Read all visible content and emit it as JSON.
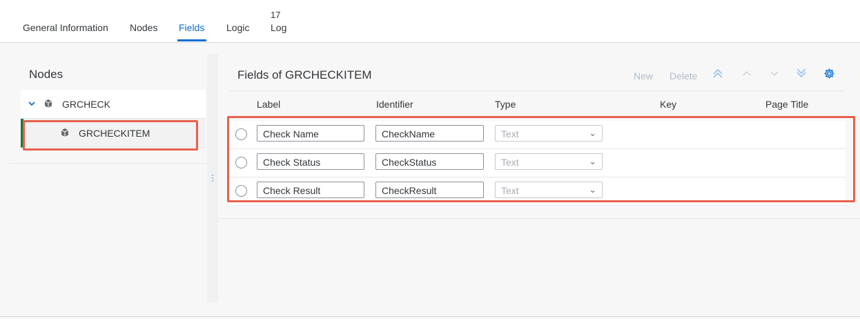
{
  "tabs": {
    "general": "General Information",
    "nodes": "Nodes",
    "fields": "Fields",
    "logic": "Logic",
    "log": "Log",
    "log_count": "17"
  },
  "nodes_panel": {
    "title": "Nodes",
    "items": [
      {
        "label": "GRCHECK",
        "expanded": true,
        "icon": "cubes-icon"
      },
      {
        "label": "GRCHECKITEM",
        "selected": true,
        "icon": "cubes-icon"
      }
    ]
  },
  "fields_panel": {
    "title": "Fields of GRCHECKITEM",
    "toolbar": {
      "new": "New",
      "delete": "Delete"
    },
    "columns": [
      "Label",
      "Identifier",
      "Type",
      "Key",
      "Page Title"
    ],
    "rows": [
      {
        "label": "Check Name",
        "identifier": "CheckName",
        "type": "Text"
      },
      {
        "label": "Check Status",
        "identifier": "CheckStatus",
        "type": "Text"
      },
      {
        "label": "Check Result",
        "identifier": "CheckResult",
        "type": "Text"
      }
    ]
  },
  "colors": {
    "accent": "#0a6ed1",
    "highlight": "#e8604c",
    "selection_bar": "#107e3e"
  }
}
